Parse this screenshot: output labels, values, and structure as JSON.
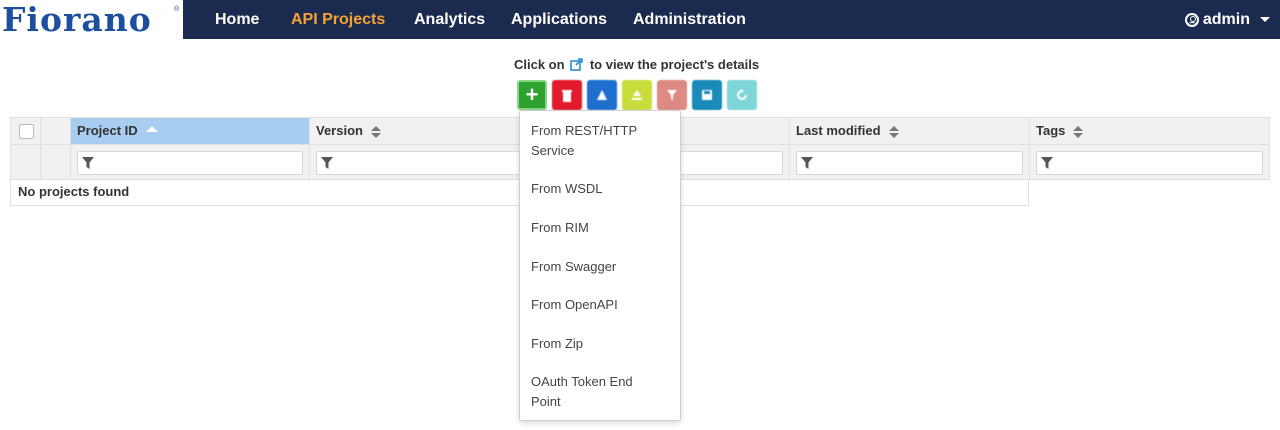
{
  "brand": {
    "logo_text": "Fiorano",
    "reg_mark": "®"
  },
  "nav": {
    "items": [
      {
        "label": "Home"
      },
      {
        "label": "API Projects"
      },
      {
        "label": "Analytics"
      },
      {
        "label": "Applications"
      },
      {
        "label": "Administration"
      }
    ],
    "active": "API Projects",
    "user": {
      "label": "admin",
      "icon": "user-circle-icon"
    }
  },
  "hint": {
    "before": "Click on",
    "after": "to view the project's details",
    "icon": "external-link-icon"
  },
  "toolbar": {
    "buttons": [
      {
        "name": "add",
        "glyph": "+",
        "color": "#2ea12f"
      },
      {
        "name": "delete",
        "color": "#e21a2c"
      },
      {
        "name": "deploy",
        "color": "#1e6fd0"
      },
      {
        "name": "deploy-multiple",
        "color": "#c9dc3b"
      },
      {
        "name": "filter",
        "color": "#dd8a82"
      },
      {
        "name": "save",
        "color": "#1a8bb8"
      },
      {
        "name": "refresh",
        "color": "#7fd6d9"
      }
    ]
  },
  "table": {
    "columns": [
      {
        "label": "Project ID",
        "sort": "asc"
      },
      {
        "label": "Version",
        "sort": "none"
      },
      {
        "label": "",
        "sort": "none"
      },
      {
        "label": "Last modified",
        "sort": "none"
      },
      {
        "label": "Tags",
        "sort": "none"
      }
    ],
    "empty_text": "No projects found"
  },
  "dropdown": {
    "items": [
      {
        "label": "From REST/HTTP Service"
      },
      {
        "label": "From WSDL"
      },
      {
        "label": "From RIM"
      },
      {
        "label": "From Swagger"
      },
      {
        "label": "From OpenAPI"
      },
      {
        "label": "From Zip"
      },
      {
        "label": "OAuth Token End Point"
      }
    ]
  },
  "colors": {
    "navbar_bg": "#1b2b4f",
    "nav_active": "#f5a233",
    "logo_blue": "#1e4f9e",
    "sorted_header_bg": "#a7cdf0"
  }
}
